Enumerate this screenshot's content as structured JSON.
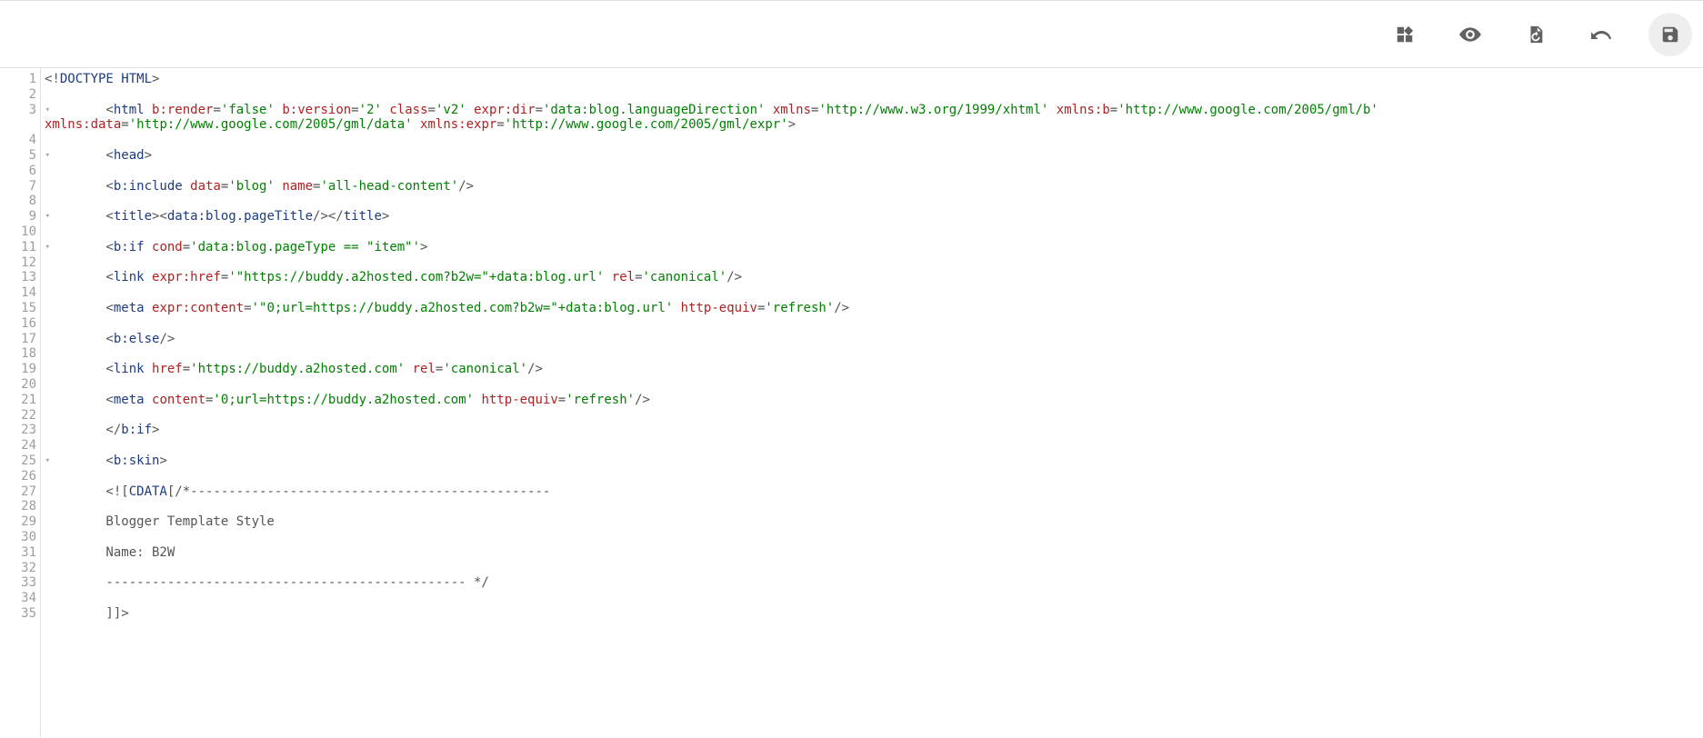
{
  "toolbar": {
    "icons": [
      "widgets-icon",
      "preview-icon",
      "restore-icon",
      "undo-icon",
      "save-icon"
    ]
  },
  "editor": {
    "lines": [
      {
        "n": 1,
        "fold": false,
        "tokens": [
          [
            "<!",
            "t-txt"
          ],
          [
            "DOCTYPE HTML",
            "t-blue"
          ],
          [
            ">",
            "t-txt"
          ]
        ]
      },
      {
        "n": 2,
        "fold": false,
        "tokens": []
      },
      {
        "n": 3,
        "fold": true,
        "tokens": [
          [
            "        <",
            "t-txt"
          ],
          [
            "html",
            "t-blue"
          ],
          [
            " ",
            "t-txt"
          ],
          [
            "b:render",
            "t-red"
          ],
          [
            "=",
            "t-txt"
          ],
          [
            "'false'",
            "t-green"
          ],
          [
            " ",
            "t-txt"
          ],
          [
            "b:version",
            "t-red"
          ],
          [
            "=",
            "t-txt"
          ],
          [
            "'2'",
            "t-green"
          ],
          [
            " ",
            "t-txt"
          ],
          [
            "class",
            "t-red"
          ],
          [
            "=",
            "t-txt"
          ],
          [
            "'v2'",
            "t-green"
          ],
          [
            " ",
            "t-txt"
          ],
          [
            "expr:dir",
            "t-red"
          ],
          [
            "=",
            "t-txt"
          ],
          [
            "'data:blog.languageDirection'",
            "t-green"
          ],
          [
            " ",
            "t-txt"
          ],
          [
            "xmlns",
            "t-red"
          ],
          [
            "=",
            "t-txt"
          ],
          [
            "'http://www.w3.org/1999/xhtml'",
            "t-green"
          ],
          [
            " ",
            "t-txt"
          ],
          [
            "xmlns:b",
            "t-red"
          ],
          [
            "=",
            "t-txt"
          ],
          [
            "'http://www.google.com/2005/gml/b'",
            "t-green"
          ],
          [
            " ",
            "t-txt"
          ]
        ]
      },
      {
        "n": 0,
        "wrap": true,
        "fold": false,
        "tokens": [
          [
            "xmlns:data",
            "t-red"
          ],
          [
            "=",
            "t-txt"
          ],
          [
            "'http://www.google.com/2005/gml/data'",
            "t-green"
          ],
          [
            " ",
            "t-txt"
          ],
          [
            "xmlns:expr",
            "t-red"
          ],
          [
            "=",
            "t-txt"
          ],
          [
            "'http://www.google.com/2005/gml/expr'",
            "t-green"
          ],
          [
            ">",
            "t-txt"
          ]
        ]
      },
      {
        "n": 4,
        "fold": false,
        "tokens": []
      },
      {
        "n": 5,
        "fold": true,
        "tokens": [
          [
            "        <",
            "t-txt"
          ],
          [
            "head",
            "t-blue"
          ],
          [
            ">",
            "t-txt"
          ]
        ]
      },
      {
        "n": 6,
        "fold": false,
        "tokens": []
      },
      {
        "n": 7,
        "fold": false,
        "tokens": [
          [
            "        <",
            "t-txt"
          ],
          [
            "b:include",
            "t-blue"
          ],
          [
            " ",
            "t-txt"
          ],
          [
            "data",
            "t-red"
          ],
          [
            "=",
            "t-txt"
          ],
          [
            "'blog'",
            "t-green"
          ],
          [
            " ",
            "t-txt"
          ],
          [
            "name",
            "t-red"
          ],
          [
            "=",
            "t-txt"
          ],
          [
            "'all-head-content'",
            "t-green"
          ],
          [
            "/>",
            "t-txt"
          ]
        ]
      },
      {
        "n": 8,
        "fold": false,
        "tokens": []
      },
      {
        "n": 9,
        "fold": true,
        "tokens": [
          [
            "        <",
            "t-txt"
          ],
          [
            "title",
            "t-blue"
          ],
          [
            "><",
            "t-txt"
          ],
          [
            "data:blog.pageTitle",
            "t-blue"
          ],
          [
            "/></",
            "t-txt"
          ],
          [
            "title",
            "t-blue"
          ],
          [
            ">",
            "t-txt"
          ]
        ]
      },
      {
        "n": 10,
        "fold": false,
        "tokens": []
      },
      {
        "n": 11,
        "fold": true,
        "tokens": [
          [
            "        <",
            "t-txt"
          ],
          [
            "b:if",
            "t-blue"
          ],
          [
            " ",
            "t-txt"
          ],
          [
            "cond",
            "t-red"
          ],
          [
            "=",
            "t-txt"
          ],
          [
            "'data:blog.pageType == \"item\"'",
            "t-green"
          ],
          [
            ">",
            "t-txt"
          ]
        ]
      },
      {
        "n": 12,
        "fold": false,
        "tokens": []
      },
      {
        "n": 13,
        "fold": false,
        "tokens": [
          [
            "        <",
            "t-txt"
          ],
          [
            "link",
            "t-blue"
          ],
          [
            " ",
            "t-txt"
          ],
          [
            "expr:href",
            "t-red"
          ],
          [
            "=",
            "t-txt"
          ],
          [
            "'\"https://buddy.a2hosted.com?b2w=\"+data:blog.url'",
            "t-green"
          ],
          [
            " ",
            "t-txt"
          ],
          [
            "rel",
            "t-red"
          ],
          [
            "=",
            "t-txt"
          ],
          [
            "'canonical'",
            "t-green"
          ],
          [
            "/>",
            "t-txt"
          ]
        ]
      },
      {
        "n": 14,
        "fold": false,
        "tokens": []
      },
      {
        "n": 15,
        "fold": false,
        "tokens": [
          [
            "        <",
            "t-txt"
          ],
          [
            "meta",
            "t-blue"
          ],
          [
            " ",
            "t-txt"
          ],
          [
            "expr:content",
            "t-red"
          ],
          [
            "=",
            "t-txt"
          ],
          [
            "'\"0;url=https://buddy.a2hosted.com?b2w=\"+data:blog.url'",
            "t-green"
          ],
          [
            " ",
            "t-txt"
          ],
          [
            "http-equiv",
            "t-red"
          ],
          [
            "=",
            "t-txt"
          ],
          [
            "'refresh'",
            "t-green"
          ],
          [
            "/>",
            "t-txt"
          ]
        ]
      },
      {
        "n": 16,
        "fold": false,
        "tokens": []
      },
      {
        "n": 17,
        "fold": false,
        "tokens": [
          [
            "        <",
            "t-txt"
          ],
          [
            "b:else",
            "t-blue"
          ],
          [
            "/>",
            "t-txt"
          ]
        ]
      },
      {
        "n": 18,
        "fold": false,
        "tokens": []
      },
      {
        "n": 19,
        "fold": false,
        "tokens": [
          [
            "        <",
            "t-txt"
          ],
          [
            "link",
            "t-blue"
          ],
          [
            " ",
            "t-txt"
          ],
          [
            "href",
            "t-red"
          ],
          [
            "=",
            "t-txt"
          ],
          [
            "'https://buddy.a2hosted.com'",
            "t-green"
          ],
          [
            " ",
            "t-txt"
          ],
          [
            "rel",
            "t-red"
          ],
          [
            "=",
            "t-txt"
          ],
          [
            "'canonical'",
            "t-green"
          ],
          [
            "/>",
            "t-txt"
          ]
        ]
      },
      {
        "n": 20,
        "fold": false,
        "tokens": []
      },
      {
        "n": 21,
        "fold": false,
        "tokens": [
          [
            "        <",
            "t-txt"
          ],
          [
            "meta",
            "t-blue"
          ],
          [
            " ",
            "t-txt"
          ],
          [
            "content",
            "t-red"
          ],
          [
            "=",
            "t-txt"
          ],
          [
            "'0;url=https://buddy.a2hosted.com'",
            "t-green"
          ],
          [
            " ",
            "t-txt"
          ],
          [
            "http-equiv",
            "t-red"
          ],
          [
            "=",
            "t-txt"
          ],
          [
            "'refresh'",
            "t-green"
          ],
          [
            "/>",
            "t-txt"
          ]
        ]
      },
      {
        "n": 22,
        "fold": false,
        "tokens": []
      },
      {
        "n": 23,
        "fold": false,
        "tokens": [
          [
            "        </",
            "t-txt"
          ],
          [
            "b:if",
            "t-blue"
          ],
          [
            ">",
            "t-txt"
          ]
        ]
      },
      {
        "n": 24,
        "fold": false,
        "tokens": []
      },
      {
        "n": 25,
        "fold": true,
        "tokens": [
          [
            "        <",
            "t-txt"
          ],
          [
            "b:skin",
            "t-blue"
          ],
          [
            ">",
            "t-txt"
          ]
        ]
      },
      {
        "n": 26,
        "fold": false,
        "tokens": []
      },
      {
        "n": 27,
        "fold": false,
        "tokens": [
          [
            "        <![",
            "t-txt"
          ],
          [
            "CDATA",
            "t-blue"
          ],
          [
            "[/*-----------------------------------------------",
            "t-txt"
          ]
        ]
      },
      {
        "n": 28,
        "fold": false,
        "tokens": []
      },
      {
        "n": 29,
        "fold": false,
        "tokens": [
          [
            "        Blogger Template Style",
            "t-txt"
          ]
        ]
      },
      {
        "n": 30,
        "fold": false,
        "tokens": []
      },
      {
        "n": 31,
        "fold": false,
        "tokens": [
          [
            "        Name: B2W",
            "t-txt"
          ]
        ]
      },
      {
        "n": 32,
        "fold": false,
        "tokens": []
      },
      {
        "n": 33,
        "fold": false,
        "tokens": [
          [
            "        ----------------------------------------------- */",
            "t-txt"
          ]
        ]
      },
      {
        "n": 34,
        "fold": false,
        "tokens": []
      },
      {
        "n": 35,
        "fold": false,
        "tokens": [
          [
            "        ]]>",
            "t-txt"
          ]
        ]
      }
    ]
  }
}
